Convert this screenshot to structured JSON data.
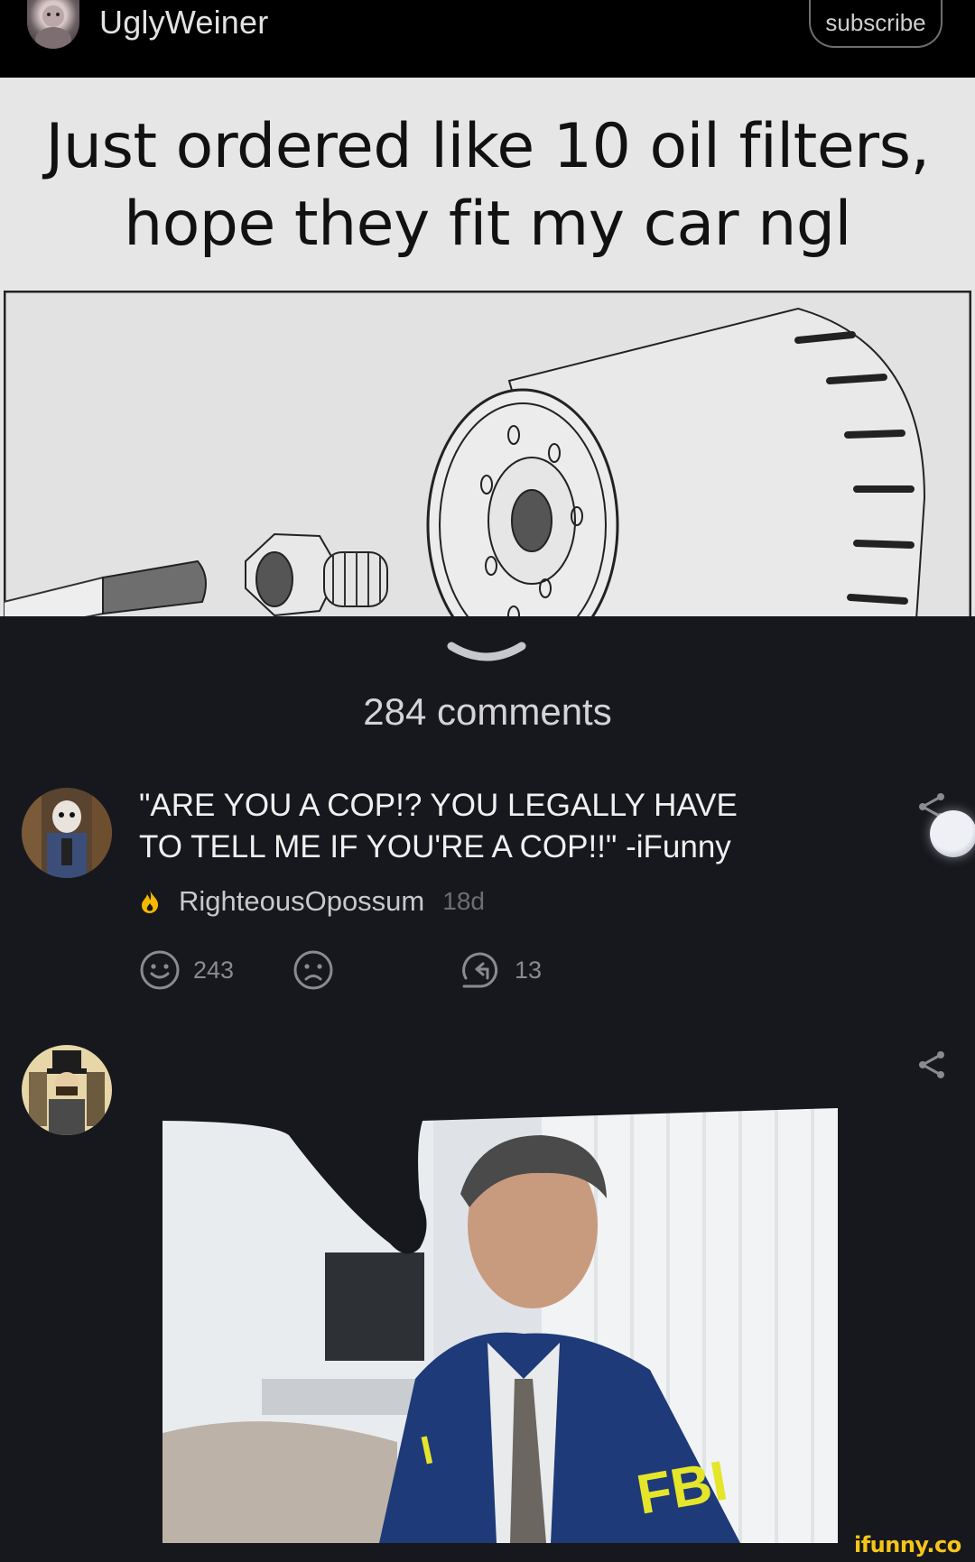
{
  "header": {
    "username": "UglyWeiner",
    "subscribe_label": "subscribe",
    "avatar_icon": "user-avatar-icon"
  },
  "meme": {
    "caption_line1": "Just ordered like 10 oil filters,",
    "caption_line2": "hope they fit my car ngl"
  },
  "comments_section": {
    "count_label": "284 comments",
    "collapse_icon": "chevron-down-icon"
  },
  "comments": [
    {
      "text_line1": "\"ARE YOU A COP!? YOU LEGALLY HAVE",
      "text_line2": "TO TELL ME IF YOU'RE A COP!!\" -iFunny",
      "author": "RighteousOpossum",
      "time": "18d",
      "smiles": "243",
      "replies": "13",
      "badge_color": "#f5b800"
    },
    {
      "attachment": "photo"
    }
  ],
  "watermark": "ifunny.co",
  "colors": {
    "background": "#17181d",
    "header": "#000000",
    "accent": "#f5c518"
  }
}
